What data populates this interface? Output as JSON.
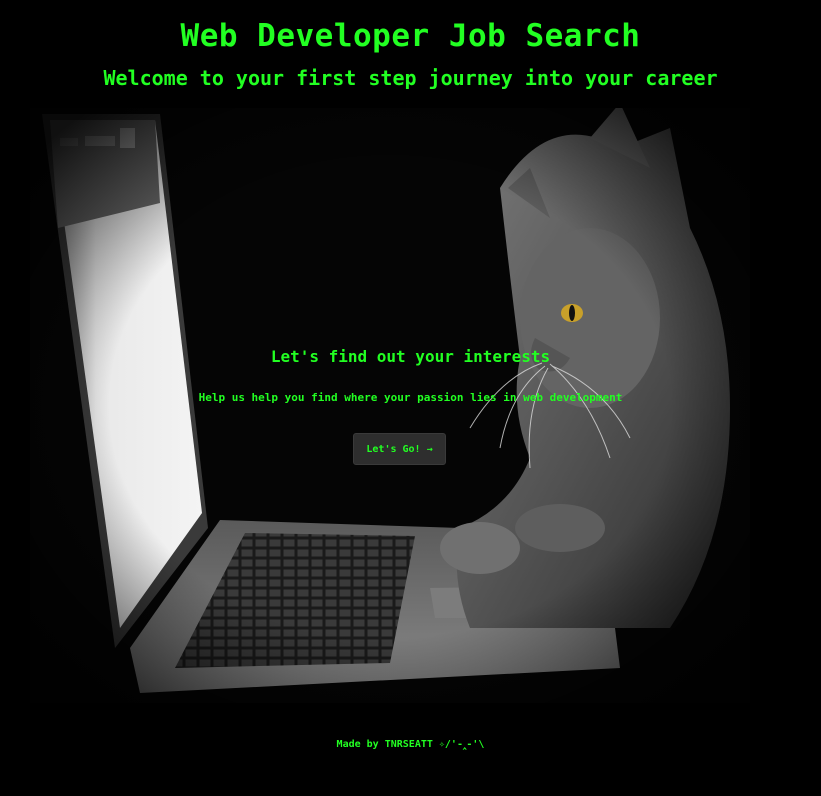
{
  "header": {
    "title": "Web Developer Job Search",
    "subtitle": "Welcome to your first step journey into your career"
  },
  "hero": {
    "image": "cat-using-laptop"
  },
  "intro": {
    "heading": "Let's find out your interests",
    "text": "Help us help you find where your passion lies in web development",
    "button_label": "Let's Go!",
    "button_icon": "→"
  },
  "footer": {
    "text": "Made by TNRSEATT ✧/'-‸-'\\"
  },
  "colors": {
    "accent": "#22ff22",
    "background": "#000000",
    "button_bg": "#2e2e2e"
  }
}
